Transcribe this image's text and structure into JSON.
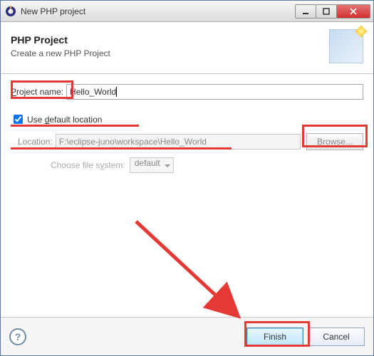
{
  "window": {
    "title": "New PHP project"
  },
  "banner": {
    "title": "PHP Project",
    "desc": "Create a new PHP Project"
  },
  "form": {
    "project_name_label": "Project name:",
    "project_name_value": "Hello_World",
    "use_default_label_prefix": "Use ",
    "use_default_label_u": "d",
    "use_default_label_suffix": "efault location",
    "use_default_checked": true,
    "location_label": "Location:",
    "location_value": "F:\\eclipse-juno\\workspace\\Hello_World",
    "browse_label": "Browse...",
    "filesystem_label": "Choose file system:",
    "filesystem_value": "default"
  },
  "buttons": {
    "finish": "Finish",
    "cancel": "Cancel"
  }
}
